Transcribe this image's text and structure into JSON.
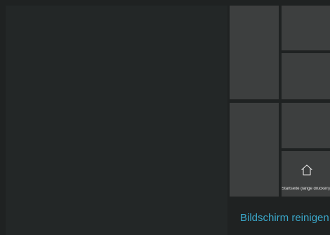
{
  "home": {
    "icon": "home-icon",
    "label": "Startseite (lange drücken)"
  },
  "clean_screen": {
    "label": "Bildschirm reinigen",
    "color": "#3aa7c9"
  },
  "colors": {
    "background": "#1f2222",
    "main_area": "#232727",
    "tile": "#3d3f3f",
    "text": "#e6e6e6"
  }
}
